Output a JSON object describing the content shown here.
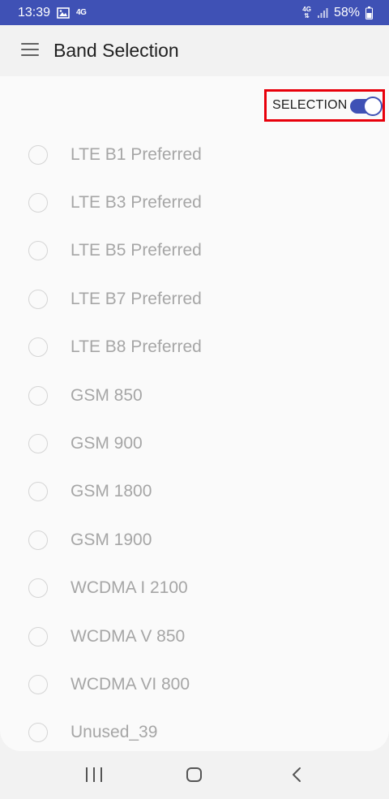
{
  "status_bar": {
    "time": "13:39",
    "network_left": "4G",
    "network_right_top": "4G",
    "network_right_bottom": "⇅",
    "battery_pct": "58%"
  },
  "app_bar": {
    "title": "Band Selection"
  },
  "selection_toggle": {
    "label": "SELECTION",
    "state": "on"
  },
  "bands": [
    {
      "label": "LTE B1 Preferred",
      "selected": false
    },
    {
      "label": "LTE B3 Preferred",
      "selected": false
    },
    {
      "label": "LTE B5 Preferred",
      "selected": false
    },
    {
      "label": "LTE B7 Preferred",
      "selected": false
    },
    {
      "label": "LTE B8 Preferred",
      "selected": false
    },
    {
      "label": "GSM 850",
      "selected": false
    },
    {
      "label": "GSM 900",
      "selected": false
    },
    {
      "label": "GSM 1800",
      "selected": false
    },
    {
      "label": "GSM 1900",
      "selected": false
    },
    {
      "label": "WCDMA I 2100",
      "selected": false
    },
    {
      "label": "WCDMA V 850",
      "selected": false
    },
    {
      "label": "WCDMA VI 800",
      "selected": false
    },
    {
      "label": "Unused_39",
      "selected": false
    }
  ],
  "colors": {
    "accent": "#3f51b5",
    "highlight_border": "#e8000b",
    "disabled_text": "#a6a6a6"
  },
  "icons": {
    "menu": "hamburger-menu-icon",
    "gallery": "image-icon",
    "signal": "signal-bars-icon",
    "battery": "battery-icon",
    "nav_recent": "recent-apps-icon",
    "nav_home": "home-icon",
    "nav_back": "back-icon"
  }
}
